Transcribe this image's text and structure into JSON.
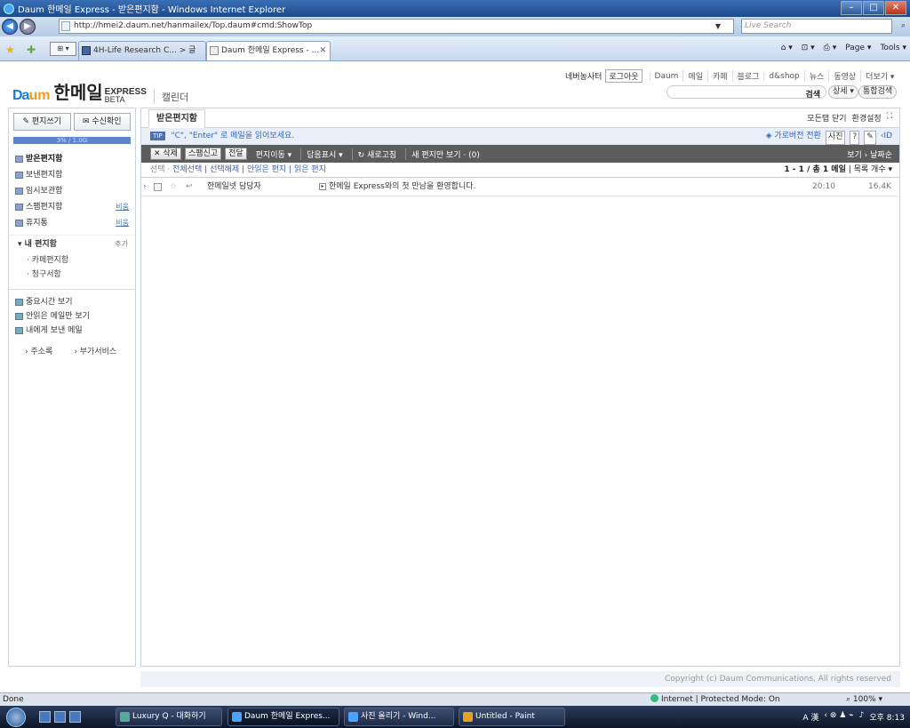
{
  "window": {
    "title": "Daum 한메일 Express - 받은편지함 - Windows Internet Explorer"
  },
  "address": {
    "url": "http://hmei2.daum.net/hanmailex/Top.daum#cmd:ShowTop",
    "search_placeholder": "Live Search"
  },
  "tabs": [
    {
      "label": "4H-Life Research C... > 글"
    },
    {
      "label": "Daum 한메일 Express - ..."
    }
  ],
  "ie_commands": {
    "page": "Page ▾",
    "tools": "Tools ▾"
  },
  "brand": {
    "daum": "Da",
    "daum2": "um",
    "product": "한메일",
    "express": "EXPRESS",
    "beta": "BETA",
    "calendar": "캘린더"
  },
  "gnb": {
    "user": "네버농사터",
    "logout": "로그아웃",
    "items": [
      "Daum",
      "메일",
      "카페",
      "블로그",
      "d&shop",
      "뉴스",
      "동영상"
    ],
    "more": "더보기 ▾",
    "search_btn": "검색",
    "detail_btn": "상세 ▾",
    "total_search": "통합검색"
  },
  "sidebar": {
    "write": "편지쓰기",
    "receive": "수신확인",
    "quota": "3% / 1.0G",
    "folders": [
      {
        "label": "받은편지함",
        "action": ""
      },
      {
        "label": "보낸편지함",
        "action": ""
      },
      {
        "label": "임시보관함",
        "action": ""
      },
      {
        "label": "스팸편지함",
        "action": "비움"
      },
      {
        "label": "휴지통",
        "action": "비움"
      }
    ],
    "my_folders": "▾ 내 편지함",
    "add": "추가",
    "sub_folders": [
      "· 카페편지함",
      "· 청구서함"
    ],
    "misc": [
      "중요시간 보기",
      "안읽은 메일만 보기",
      "내에게 보낸 메일"
    ],
    "bottom": [
      "› 주소록",
      "› 부가서비스"
    ]
  },
  "main": {
    "tab": "받은편지함",
    "tools": [
      "모든탭 닫기",
      "환경설정",
      "⛶"
    ],
    "tip_tag": "TIP",
    "tip_text": "\"C\", \"Enter\" 로 메일을 읽어보세요.",
    "tip_right": "◈ 가로버전 전환",
    "tip_b1": "사진",
    "tip_b2": "?",
    "tip_b3": "✎",
    "tip_b4": "‹ID",
    "toolbar": {
      "delete": "✕ 삭제",
      "spam": "스팸신고",
      "forward": "전달",
      "move": "편지이동 ▾",
      "reply": "답음표시 ▾",
      "refresh": "↻ 새로고침",
      "unread": "새 편지만 보기 · (0)",
      "sort": "보기 › 날짜순"
    },
    "filter": {
      "select": "선택 ·",
      "all": "전체선택",
      "release": "선택해제",
      "unread": "안읽은 편지",
      "read": "읽은 편지",
      "count": "1 - 1 / 총 1 메일",
      "view": "목록 개수 ▾"
    },
    "mails": [
      {
        "from": "한메일넷 담당자",
        "subject": "한메일 Express와의 첫 만남을 환영합니다.",
        "time": "20:10",
        "size": "16.4K"
      }
    ],
    "copyright": "Copyright (c) Daum Communications, All rights reserved"
  },
  "status": {
    "left": "Done",
    "zone": "Internet | Protected Mode: On",
    "zoom": "100% ▾"
  },
  "taskbar": {
    "tasks": [
      "Luxury Q - 대화하기",
      "Daum 한메일 Expres...",
      "사진 올리기 - Wind...",
      "Untitled - Paint"
    ],
    "clock": "오후 8:13"
  }
}
